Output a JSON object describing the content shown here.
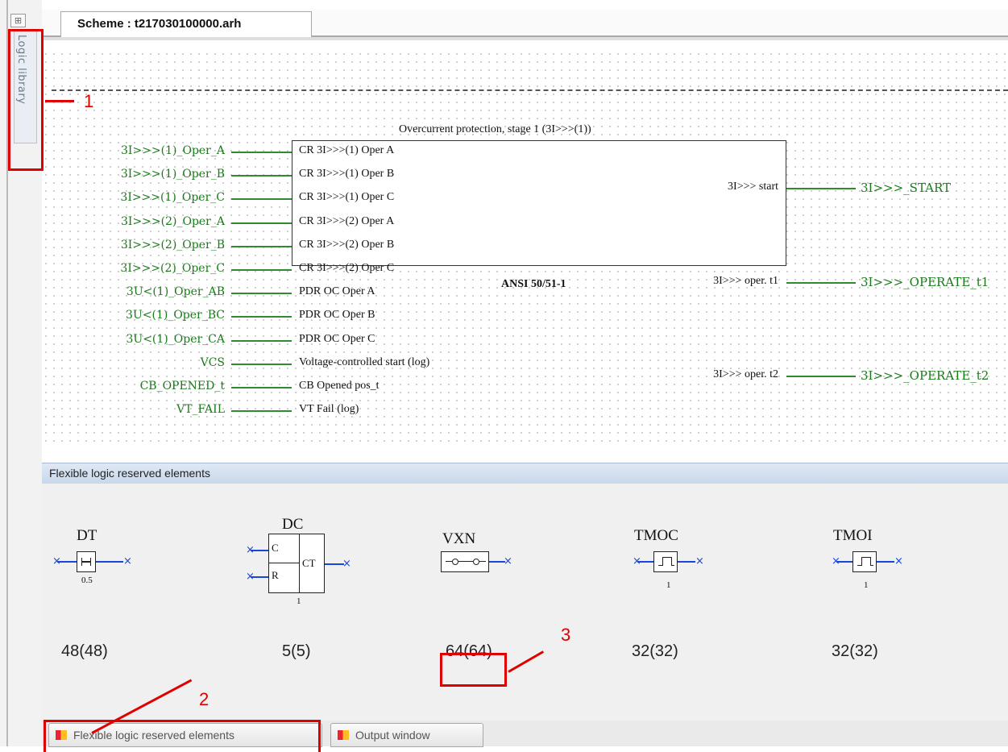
{
  "scheme_tab": {
    "label": "Scheme : t217030100000.arh"
  },
  "side_tab": {
    "label": "Logic library"
  },
  "block": {
    "title": "Overcurrent protection, stage 1 (3I>>>(1))",
    "name": "ANSI 50/51-1",
    "inputs": [
      {
        "signal": "3I>>>(1)_Oper_A",
        "pin": "CR 3I>>>(1) Oper A"
      },
      {
        "signal": "3I>>>(1)_Oper_B",
        "pin": "CR 3I>>>(1) Oper B"
      },
      {
        "signal": "3I>>>(1)_Oper_C",
        "pin": "CR 3I>>>(1) Oper C"
      },
      {
        "signal": "3I>>>(2)_Oper_A",
        "pin": "CR 3I>>>(2) Oper A"
      },
      {
        "signal": "3I>>>(2)_Oper_B",
        "pin": "CR 3I>>>(2) Oper B"
      },
      {
        "signal": "3I>>>(2)_Oper_C",
        "pin": "CR 3I>>>(2) Oper C"
      },
      {
        "signal": "3U<(1)_Oper_AB",
        "pin": "PDR OC Oper A"
      },
      {
        "signal": "3U<(1)_Oper_BC",
        "pin": "PDR OC Oper B"
      },
      {
        "signal": "3U<(1)_Oper_CA",
        "pin": "PDR OC Oper C"
      },
      {
        "signal": "VCS",
        "pin": "Voltage-controlled start (log)"
      },
      {
        "signal": "CB_OPENED_t",
        "pin": "CB Opened pos_t"
      },
      {
        "signal": "VT_FAIL",
        "pin": "VT Fail (log)"
      }
    ],
    "outputs": [
      {
        "pin": "3I>>> start",
        "signal": "3I>>>_START"
      },
      {
        "pin": "3I>>> oper. t1",
        "signal": "3I>>>_OPERATE_t1"
      },
      {
        "pin": "3I>>> oper. t2",
        "signal": "3I>>>_OPERATE_t2"
      }
    ]
  },
  "panel": {
    "title": "Flexible logic reserved elements",
    "elements": [
      {
        "name": "DT",
        "sub": "0.5",
        "count": "48(48)",
        "icon": "timer-delay-icon"
      },
      {
        "name": "DC",
        "sub": "1",
        "count": "5(5)",
        "icon": "counter-icon",
        "pins": [
          "C",
          "R",
          "CT"
        ]
      },
      {
        "name": "VXN",
        "sub": "",
        "count": "64(64)",
        "icon": "switch-icon"
      },
      {
        "name": "TMOC",
        "sub": "1",
        "count": "32(32)",
        "icon": "pulse-icon"
      },
      {
        "name": "TMOI",
        "sub": "1",
        "count": "32(32)",
        "icon": "pulse-icon"
      }
    ]
  },
  "bottom_tabs": [
    {
      "label": "Flexible logic reserved elements"
    },
    {
      "label": "Output window"
    }
  ],
  "callouts": [
    "1",
    "2",
    "3"
  ],
  "colors": {
    "signal": "#1a7a1a",
    "callout": "#e00000",
    "pin_wire": "#1a46d8"
  }
}
